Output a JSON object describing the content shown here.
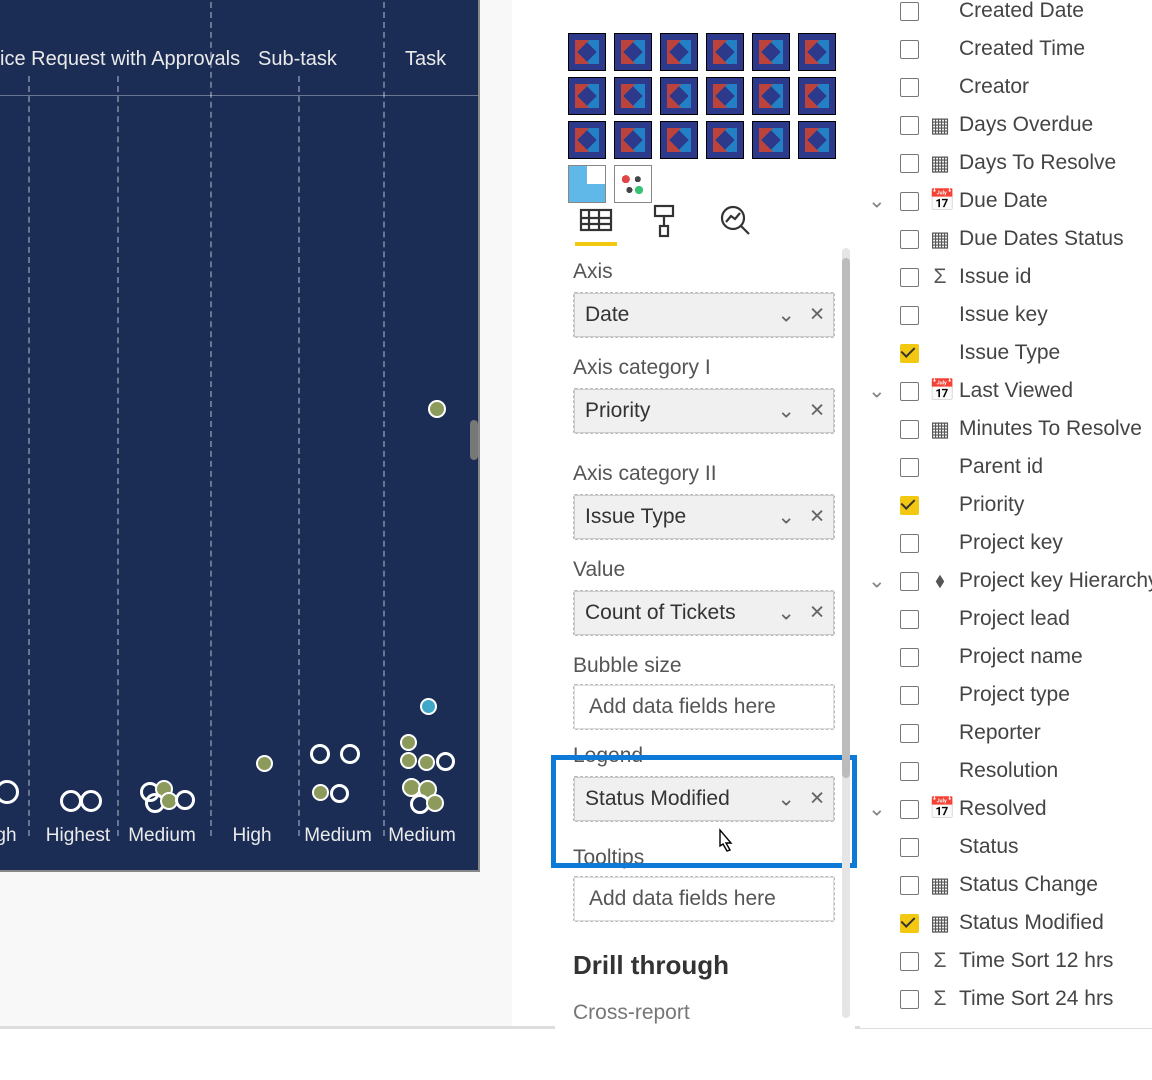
{
  "chart": {
    "headers": [
      "ice Request with Approvals",
      "Sub-task",
      "Task"
    ],
    "axis_labels": [
      "gh",
      "Highest",
      "Medium",
      "High",
      "Medium",
      "Medium"
    ]
  },
  "viz": {
    "tabs": {
      "fields": "Fields",
      "format": "Format",
      "analytics": "Analytics"
    },
    "sections": {
      "axis_label": "Axis",
      "axis_value": "Date",
      "cat1_label": "Axis category I",
      "cat1_value": "Priority",
      "cat2_label": "Axis category II",
      "cat2_value": "Issue Type",
      "value_label": "Value",
      "value_value": "Count of Tickets",
      "bubble_label": "Bubble size",
      "bubble_placeholder": "Add data fields here",
      "legend_label": "Legend",
      "legend_value": "Status Modified",
      "tooltips_label": "Tooltips",
      "tooltips_placeholder": "Add data fields here",
      "drill_title": "Drill through",
      "cross_label": "Cross-report"
    }
  },
  "fields": [
    {
      "label": "Created Date",
      "checked": false,
      "icon": "",
      "expand": false
    },
    {
      "label": "Created Time",
      "checked": false,
      "icon": "",
      "expand": false
    },
    {
      "label": "Creator",
      "checked": false,
      "icon": "",
      "expand": false
    },
    {
      "label": "Days Overdue",
      "checked": false,
      "icon": "table",
      "expand": false
    },
    {
      "label": "Days To Resolve",
      "checked": false,
      "icon": "table",
      "expand": false
    },
    {
      "label": "Due Date",
      "checked": false,
      "icon": "calendar",
      "expand": true
    },
    {
      "label": "Due Dates Status",
      "checked": false,
      "icon": "table",
      "expand": false
    },
    {
      "label": "Issue id",
      "checked": false,
      "icon": "sigma",
      "expand": false
    },
    {
      "label": "Issue key",
      "checked": false,
      "icon": "",
      "expand": false
    },
    {
      "label": "Issue Type",
      "checked": true,
      "icon": "",
      "expand": false
    },
    {
      "label": "Last Viewed",
      "checked": false,
      "icon": "calendar",
      "expand": true
    },
    {
      "label": "Minutes To Resolve",
      "checked": false,
      "icon": "table",
      "expand": false
    },
    {
      "label": "Parent id",
      "checked": false,
      "icon": "",
      "expand": false
    },
    {
      "label": "Priority",
      "checked": true,
      "icon": "",
      "expand": false
    },
    {
      "label": "Project key",
      "checked": false,
      "icon": "",
      "expand": false
    },
    {
      "label": "Project key Hierarchy",
      "checked": false,
      "icon": "hierarchy",
      "expand": true
    },
    {
      "label": "Project lead",
      "checked": false,
      "icon": "",
      "expand": false
    },
    {
      "label": "Project name",
      "checked": false,
      "icon": "",
      "expand": false
    },
    {
      "label": "Project type",
      "checked": false,
      "icon": "",
      "expand": false
    },
    {
      "label": "Reporter",
      "checked": false,
      "icon": "",
      "expand": false
    },
    {
      "label": "Resolution",
      "checked": false,
      "icon": "",
      "expand": false
    },
    {
      "label": "Resolved",
      "checked": false,
      "icon": "calendar",
      "expand": true
    },
    {
      "label": "Status",
      "checked": false,
      "icon": "",
      "expand": false
    },
    {
      "label": "Status Change",
      "checked": false,
      "icon": "table",
      "expand": false
    },
    {
      "label": "Status Modified",
      "checked": true,
      "icon": "table",
      "expand": false
    },
    {
      "label": "Time Sort 12 hrs",
      "checked": false,
      "icon": "sigma",
      "expand": false
    },
    {
      "label": "Time Sort 24 hrs",
      "checked": false,
      "icon": "sigma",
      "expand": false
    }
  ]
}
